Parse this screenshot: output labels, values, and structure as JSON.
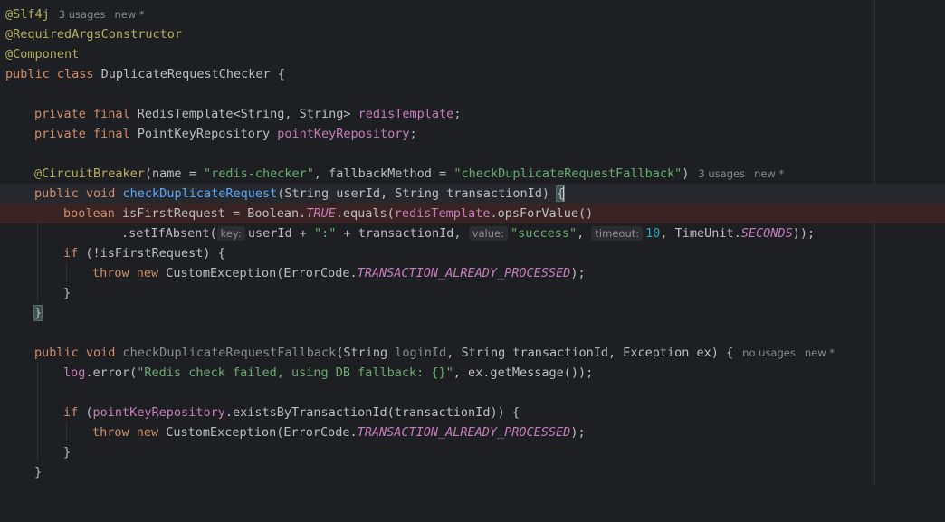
{
  "lines": [
    {
      "ann": "@Slf4j",
      "usages": "3 usages",
      "status": "new *"
    },
    {
      "ann": "@RequiredArgsConstructor"
    },
    {
      "ann": "@Component"
    },
    {
      "kw": "public class ",
      "name": "DuplicateRequestChecker",
      "rest": " {"
    },
    {},
    {
      "kw": "private final ",
      "type": "RedisTemplate<String, String> ",
      "field": "redisTemplate",
      "end": ";"
    },
    {
      "kw": "private final ",
      "type": "PointKeyRepository ",
      "field": "pointKeyRepository",
      "end": ";"
    },
    {},
    {
      "ann": "@CircuitBreaker",
      "p1": "(name = ",
      "s1": "\"redis-checker\"",
      "p2": ", fallbackMethod = ",
      "s2": "\"checkDuplicateRequestFallback\"",
      "p3": ")",
      "usages": "3 usages",
      "status": "new *"
    },
    {
      "kw": "public void ",
      "fn": "checkDuplicateRequest",
      "rest": "(String userId, String transactionId) ",
      "brace": "{"
    },
    {
      "kw": "boolean ",
      "a": "isFirstRequest = Boolean.",
      "c": "TRUE",
      "b": ".equals(",
      "f": "redisTemplate",
      "d": ".opsForValue()"
    },
    {
      "a": ".setIfAbsent(",
      "h1": "key:",
      "b": "userId + ",
      "s1": "\":\"",
      "c": " + transactionId, ",
      "h2": "value:",
      "s2": "\"success\"",
      "d": ", ",
      "h3": "timeout:",
      "n": "10",
      "e": ", TimeUnit.",
      "k": "SECONDS",
      "f": "));"
    },
    {
      "kw": "if ",
      "rest": "(!isFirstRequest) {"
    },
    {
      "kw": "throw new ",
      "a": "CustomException(ErrorCode.",
      "c": "TRANSACTION_ALREADY_PROCESSED",
      "b": ");"
    },
    {
      "rest": "}"
    },
    {
      "rest": "}"
    },
    {},
    {
      "kw": "public void ",
      "fn": "checkDuplicateRequestFallback",
      "a": "(String ",
      "u": "loginId",
      "b": ", String transactionId, Exception ex) {",
      "usages": "no usages",
      "status": "new *"
    },
    {
      "f": "log",
      "a": ".error(",
      "s": "\"Redis check failed, using DB fallback: {}\"",
      "b": ", ex.getMessage());"
    },
    {},
    {
      "kw": "if ",
      "a": "(",
      "f": "pointKeyRepository",
      "b": ".existsByTransactionId(transactionId)) {"
    },
    {
      "kw": "throw new ",
      "a": "CustomException(ErrorCode.",
      "c": "TRANSACTION_ALREADY_PROCESSED",
      "b": ");"
    },
    {
      "rest": "}"
    },
    {
      "rest": "}"
    }
  ]
}
